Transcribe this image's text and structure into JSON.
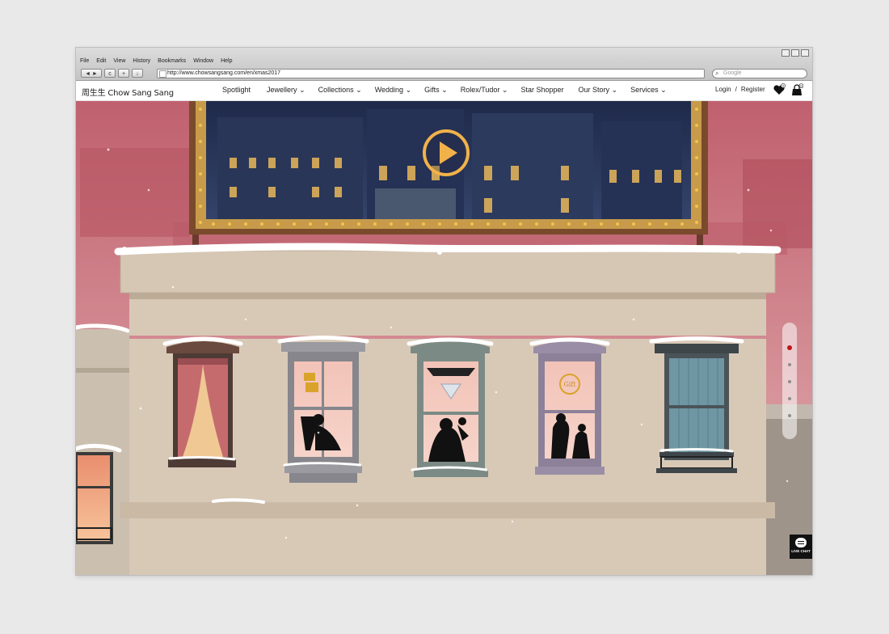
{
  "browser": {
    "menu": [
      "File",
      "Edit",
      "View",
      "History",
      "Bookmarks",
      "Window",
      "Help"
    ],
    "url": "http://www.chowsangsang.com/en/xmas2017",
    "search_placeholder": "Google",
    "buttons": {
      "back": "◄ ►",
      "reload": "c",
      "add": "+",
      "download": "↓"
    }
  },
  "site": {
    "logo": "周生生 Chow Sang Sang",
    "nav": [
      {
        "label": "Spotlight",
        "caret": ""
      },
      {
        "label": "Jewellery",
        "caret": "⌄"
      },
      {
        "label": "Collections",
        "caret": "⌄"
      },
      {
        "label": "Wedding",
        "caret": "⌄"
      },
      {
        "label": "Gifts",
        "caret": "⌄"
      },
      {
        "label": "Rolex/Tudor",
        "caret": "⌄"
      },
      {
        "label": "Star Shopper",
        "caret": ""
      },
      {
        "label": "Our Story",
        "caret": "⌄"
      },
      {
        "label": "Services",
        "caret": "⌄"
      }
    ],
    "login": "Login",
    "separator": "/",
    "register": "Register",
    "wishlist_count": "0",
    "cart_count": "0"
  },
  "scene": {
    "window_sign": "Gift",
    "pager": {
      "total": 5,
      "active": 1
    }
  },
  "live_chat": "LIVE CHAT",
  "colors": {
    "sky": "#c76b78",
    "building": "#d8c9b7",
    "accent": "#f2b24a",
    "pager_active": "#c0141d"
  }
}
